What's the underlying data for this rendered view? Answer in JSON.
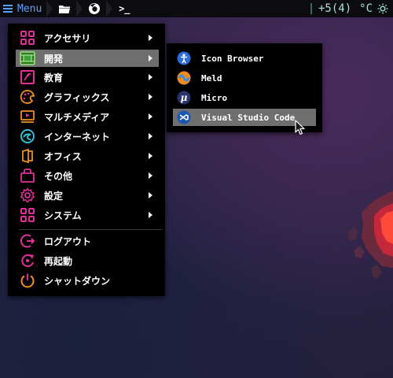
{
  "panel": {
    "menu_label": "Menu",
    "launchers": [
      "folder-icon",
      "firefox-icon",
      "terminal-icon"
    ],
    "terminal_glyph": ">_",
    "tray": {
      "updates_text": "+5(4)",
      "temperature_text": "°C"
    }
  },
  "menu": {
    "items": [
      {
        "label": "アクセサリ",
        "icon": "accessories-icon",
        "submenu": true,
        "active": false
      },
      {
        "label": "開発",
        "icon": "development-icon",
        "submenu": true,
        "active": true
      },
      {
        "label": "教育",
        "icon": "education-icon",
        "submenu": true,
        "active": false
      },
      {
        "label": "グラフィックス",
        "icon": "graphics-icon",
        "submenu": true,
        "active": false
      },
      {
        "label": "マルチメディア",
        "icon": "multimedia-icon",
        "submenu": true,
        "active": false
      },
      {
        "label": "インターネット",
        "icon": "internet-icon",
        "submenu": true,
        "active": false
      },
      {
        "label": "オフィス",
        "icon": "office-icon",
        "submenu": true,
        "active": false
      },
      {
        "label": "その他",
        "icon": "other-icon",
        "submenu": true,
        "active": false
      },
      {
        "label": "設定",
        "icon": "settings-icon",
        "submenu": true,
        "active": false
      },
      {
        "label": "システム",
        "icon": "system-icon",
        "submenu": true,
        "active": false
      }
    ],
    "actions": [
      {
        "label": "ログアウト",
        "icon": "logout-icon"
      },
      {
        "label": "再起動",
        "icon": "reboot-icon"
      },
      {
        "label": "シャットダウン",
        "icon": "shutdown-icon"
      }
    ]
  },
  "submenu": {
    "items": [
      {
        "label": "Icon Browser",
        "icon": "icon-browser-icon",
        "active": false
      },
      {
        "label": "Meld",
        "icon": "meld-icon",
        "active": false
      },
      {
        "label": "Micro",
        "icon": "micro-icon",
        "active": false
      },
      {
        "label": "Visual Studio Code",
        "icon": "vscode-icon",
        "active": true
      }
    ]
  },
  "colors": {
    "panel_bg": "#0c0c10",
    "panel_accent": "#5aa0ff",
    "tray_text": "#9fe3d8",
    "menu_bg": "#000000",
    "highlight": "#6f6f6f",
    "icon_magenta": "#e0309a",
    "icon_orange": "#f0901e",
    "icon_cyan": "#2ec0d8"
  }
}
